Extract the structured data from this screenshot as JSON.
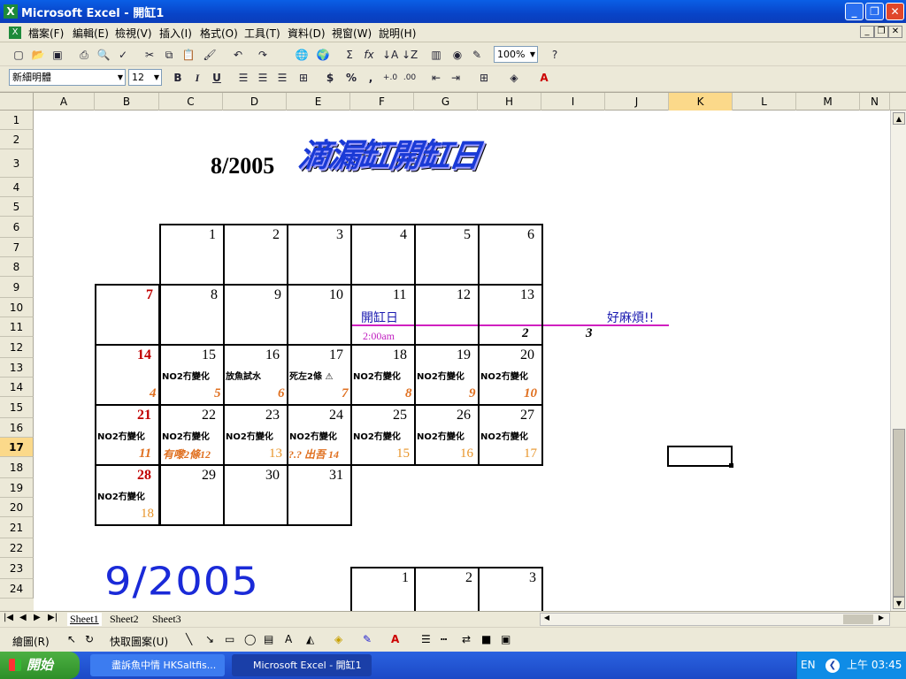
{
  "window": {
    "title": "Microsoft Excel - 開缸1",
    "min": "_",
    "restore": "❐",
    "close": "✕"
  },
  "menu": [
    "檔案(F)",
    "編輯(E)",
    "檢視(V)",
    "插入(I)",
    "格式(O)",
    "工具(T)",
    "資料(D)",
    "視窗(W)",
    "說明(H)"
  ],
  "toolbar": {
    "zoom": "100%",
    "font": "新細明體",
    "size": "12",
    "bold": "B",
    "italic": "I",
    "underline": "U",
    "currency": "$",
    "percent": "%",
    "comma": ","
  },
  "columns": [
    "A",
    "B",
    "C",
    "D",
    "E",
    "F",
    "G",
    "H",
    "I",
    "J",
    "K",
    "L",
    "M",
    "N"
  ],
  "rows": [
    "1",
    "2",
    "3",
    "4",
    "5",
    "6",
    "7",
    "8",
    "9",
    "10",
    "11",
    "12",
    "13",
    "14",
    "15",
    "16",
    "17",
    "18",
    "19",
    "20",
    "21",
    "22",
    "23",
    "24"
  ],
  "sheet": {
    "month_aug": "8/2005",
    "title_art": "滴漏缸開缸日",
    "month_sep": "9/2005",
    "open_day": "開缸日",
    "open_time": "2:00am",
    "annoyed": "好麻煩!!",
    "week1": [
      "1",
      "2",
      "3",
      "4",
      "5",
      "6"
    ],
    "week2": [
      "7",
      "8",
      "9",
      "10",
      "11",
      "12",
      "13"
    ],
    "week2_counts": [
      "2",
      "3"
    ],
    "week3": [
      "14",
      "15",
      "16",
      "17",
      "18",
      "19",
      "20"
    ],
    "week3_notes": [
      "NO2冇變化",
      "放魚試水",
      "死左2條 ⚠",
      "NO2冇變化",
      "NO2冇變化",
      "NO2冇變化"
    ],
    "week3_counts": [
      "4",
      "5",
      "6",
      "7",
      "8",
      "9",
      "10"
    ],
    "week4": [
      "21",
      "22",
      "23",
      "24",
      "25",
      "26",
      "27"
    ],
    "week4_notes": [
      "NO2冇變化",
      "NO2冇變化",
      "NO2冇變化",
      "NO2冇變化",
      "NO2冇變化",
      "NO2冇變化",
      "NO2冇變化"
    ],
    "week4_counts": [
      "11",
      "有嚟2條12",
      "13",
      "?.? 出吾 14",
      "15",
      "16",
      "17"
    ],
    "week5": [
      "28",
      "29",
      "30",
      "31"
    ],
    "week5_note": "NO2冇變化",
    "week5_count": "18",
    "sep_days": [
      "1",
      "2",
      "3"
    ]
  },
  "sheets": [
    "Sheet1",
    "Sheet2",
    "Sheet3"
  ],
  "drawbar": {
    "draw": "繪圖(R)",
    "autoshapes": "快取圖案(U)"
  },
  "taskbar": {
    "start": "開始",
    "task1": "盡訴魚中情 HKSaltfis...",
    "task2": "Microsoft Excel - 開缸1",
    "lang": "EN",
    "clock": "上午 03:45"
  },
  "colors": {
    "title_blue": "#0a5fe6",
    "pink_line": "#d020c0",
    "orange": "#e07020"
  }
}
